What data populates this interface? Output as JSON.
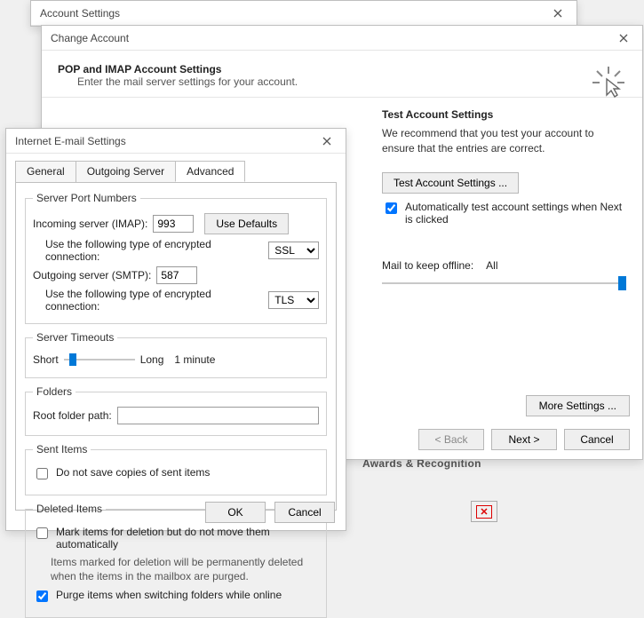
{
  "acct": {
    "title": "Account Settings"
  },
  "change": {
    "title": "Change Account",
    "header_bold": "POP and IMAP Account Settings",
    "header_sub": "Enter the mail server settings for your account.",
    "test_title": "Test Account Settings",
    "test_text": "We recommend that you test your account to ensure that the entries are correct.",
    "test_btn": "Test Account Settings ...",
    "auto_test": "Automatically test account settings when Next is clicked",
    "mail_keep_label": "Mail to keep offline:",
    "mail_keep_value": "All",
    "more_settings": "More Settings ...",
    "back": "< Back",
    "next": "Next >",
    "cancel": "Cancel"
  },
  "inet": {
    "title": "Internet E-mail Settings",
    "tabs": {
      "general": "General",
      "outgoing": "Outgoing Server",
      "advanced": "Advanced"
    },
    "group_ports": "Server Port Numbers",
    "incoming_label": "Incoming server (IMAP):",
    "incoming_port": "993",
    "use_defaults": "Use Defaults",
    "enc_label": "Use the following type of encrypted connection:",
    "incoming_enc": "SSL",
    "outgoing_label": "Outgoing server (SMTP):",
    "outgoing_port": "587",
    "outgoing_enc": "TLS",
    "group_timeouts": "Server Timeouts",
    "timeout_short": "Short",
    "timeout_long": "Long",
    "timeout_value": "1 minute",
    "group_folders": "Folders",
    "root_label": "Root folder path:",
    "root_value": "",
    "group_sent": "Sent Items",
    "sent_chk": "Do not save copies of sent items",
    "group_deleted": "Deleted Items",
    "del_mark": "Mark items for deletion but do not move them automatically",
    "del_help": "Items marked for deletion will be permanently deleted when the items in the mailbox are purged.",
    "del_purge": "Purge items when switching folders while online",
    "ok": "OK",
    "cancel": "Cancel"
  },
  "behind": {
    "frag": "Awards & Recognition"
  }
}
